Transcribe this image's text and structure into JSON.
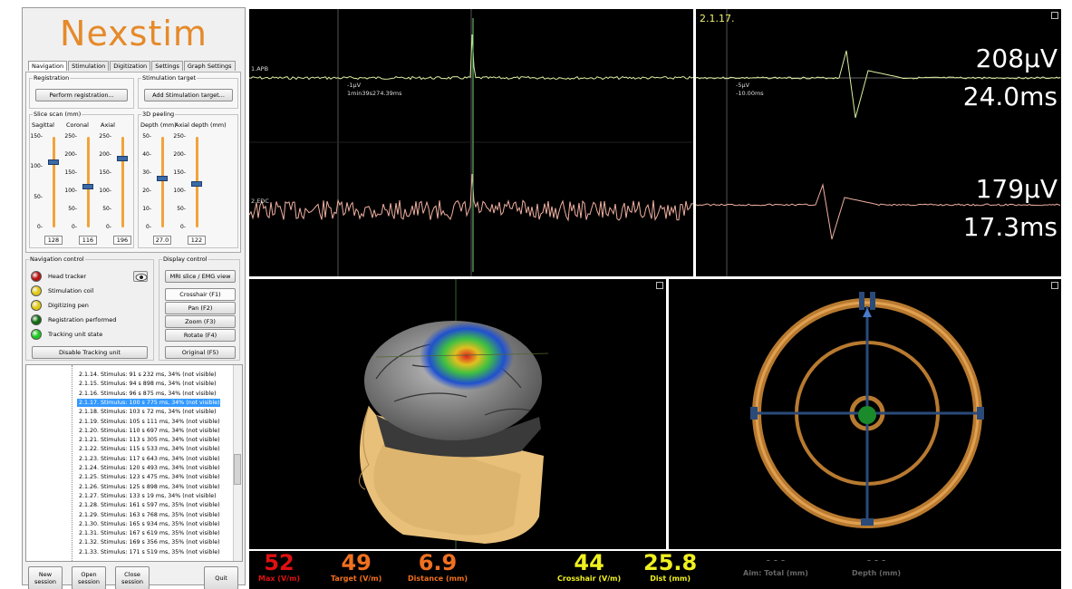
{
  "app": {
    "logo": "Nexstim"
  },
  "tabs": [
    "Navigation",
    "Stimulation",
    "Digitization",
    "Settings",
    "Graph Settings"
  ],
  "registration": {
    "label": "Registration",
    "button": "Perform registration..."
  },
  "stim_target": {
    "label": "Stimulation target",
    "button": "Add Stimulation target..."
  },
  "slice_scan": {
    "label": "Slice scan (mm)",
    "sliders": [
      {
        "name": "Sagittal",
        "ticks": [
          "150-",
          "100-",
          "50-",
          "0-"
        ],
        "value": "128",
        "level": 0.72
      },
      {
        "name": "Coronal",
        "ticks": [
          "250-",
          "200-",
          "150-",
          "100-",
          "50-",
          "0-"
        ],
        "value": "116",
        "level": 0.45
      },
      {
        "name": "Axial",
        "ticks": [
          "250-",
          "200-",
          "150-",
          "100-",
          "50-",
          "0-"
        ],
        "value": "196",
        "level": 0.76
      }
    ]
  },
  "peeling": {
    "label": "3D peeling",
    "sliders": [
      {
        "name": "Depth (mm)",
        "ticks": [
          "50-",
          "40-",
          "30-",
          "20-",
          "10-",
          "0-"
        ],
        "value": "27.0",
        "level": 0.54
      },
      {
        "name": "Axial depth (mm)",
        "ticks": [
          "250-",
          "200-",
          "150-",
          "100-",
          "50-",
          "0-"
        ],
        "value": "122",
        "level": 0.48
      }
    ]
  },
  "nav_control": {
    "label": "Navigation control",
    "items": [
      {
        "label": "Head tracker",
        "color": "#b81414"
      },
      {
        "label": "Stimulation coil",
        "color": "#e0c814"
      },
      {
        "label": "Digitizing pen",
        "color": "#e0c814"
      },
      {
        "label": "Registration performed",
        "color": "#0f6b0f"
      },
      {
        "label": "Tracking unit state",
        "color": "#1ec81e"
      }
    ],
    "disable_button": "Disable Tracking unit"
  },
  "display_control": {
    "label": "Display control",
    "buttons": [
      "MRI slice / EMG view",
      "Crosshair   (F1)",
      "Pan          (F2)",
      "Zoom        (F3)",
      "Rotate      (F4)",
      "Original     (F5)"
    ]
  },
  "stimulus_list": [
    "2.1.14. Stimulus: 91 s 232 ms, 34% (not visible)",
    "2.1.15. Stimulus: 94 s 898 ms, 34% (not visible)",
    "2.1.16. Stimulus: 96 s 875 ms, 34% (not visible)",
    "2.1.17. Stimulus: 100 s 775 ms, 34% (not visible)",
    "2.1.18. Stimulus: 103 s 72 ms, 34% (not visible)",
    "2.1.19. Stimulus: 105 s 111 ms, 34% (not visible)",
    "2.1.20. Stimulus: 110 s 697 ms, 34% (not visible)",
    "2.1.21. Stimulus: 113 s 305 ms, 34% (not visible)",
    "2.1.22. Stimulus: 115 s 533 ms, 34% (not visible)",
    "2.1.23. Stimulus: 117 s 643 ms, 34% (not visible)",
    "2.1.24. Stimulus: 120 s 493 ms, 34% (not visible)",
    "2.1.25. Stimulus: 123 s 475 ms, 34% (not visible)",
    "2.1.26. Stimulus: 125 s 898 ms, 34% (not visible)",
    "2.1.27. Stimulus: 133 s 19 ms, 34% (not visible)",
    "2.1.28. Stimulus: 161 s 597 ms, 35% (not visible)",
    "2.1.29. Stimulus: 163 s 768 ms, 35% (not visible)",
    "2.1.30. Stimulus: 165 s 934 ms, 35% (not visible)",
    "2.1.31. Stimulus: 167 s 619 ms, 35% (not visible)",
    "2.1.32. Stimulus: 169 s 356 ms, 35% (not visible)",
    "2.1.33. Stimulus: 171 s 519 ms, 35% (not visible)"
  ],
  "selected_index": 3,
  "bottom_buttons": [
    "New session",
    "Open session",
    "Close session",
    "Quit"
  ],
  "emg": {
    "ch1": "1.APB",
    "ch2": "2.EDC",
    "cursor_main_1": "-1µV",
    "cursor_main_2": "1min39s274.39ms",
    "zoom_title": "2.1.17.",
    "cursor_zoom_1": "-5µV",
    "cursor_zoom_2": "-10.00ms",
    "apb_amp": "208µV",
    "apb_lat": "24.0ms",
    "edc_amp": "179µV",
    "edc_lat": "17.3ms",
    "ch1_color": "#d8f0a0",
    "ch2_color": "#f0b0a0"
  },
  "status": [
    {
      "num": "52",
      "label": "Max (V/m)",
      "color": "#e01010"
    },
    {
      "num": "49",
      "label": "Target (V/m)",
      "color": "#f07020"
    },
    {
      "num": "6.9",
      "label": "Distance (mm)",
      "color": "#f07020"
    },
    {
      "num": "44",
      "label": "Crosshair (V/m)",
      "color": "#f0f020"
    },
    {
      "num": "25.8",
      "label": "Dist (mm)",
      "color": "#f0f020"
    },
    {
      "num": "- - -",
      "label": "Aim: Total (mm)",
      "color": "#666666"
    },
    {
      "num": "- - -",
      "label": "Depth (mm)",
      "color": "#666666"
    }
  ]
}
